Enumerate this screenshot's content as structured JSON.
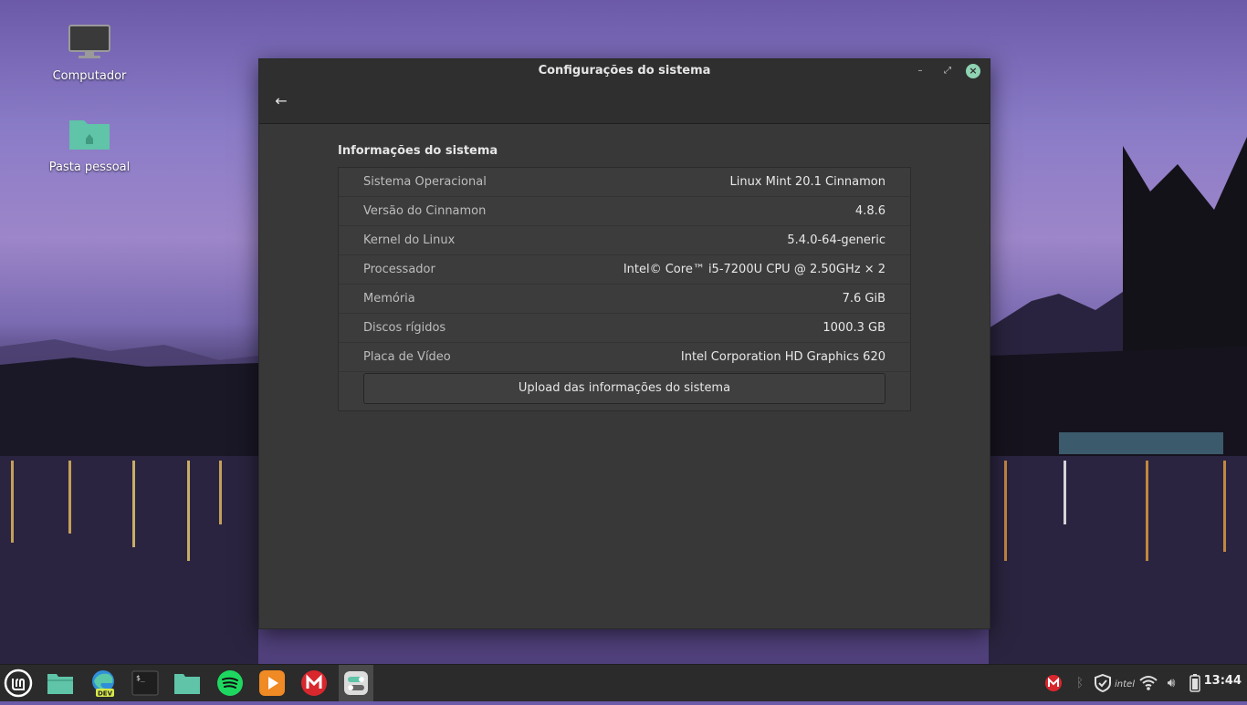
{
  "desktop": {
    "icons": [
      {
        "label": "Computador",
        "icon": "monitor-icon"
      },
      {
        "label": "Pasta pessoal",
        "icon": "home-folder-icon"
      }
    ]
  },
  "window": {
    "title": "Configurações do sistema",
    "section_title": "Informações do sistema",
    "rows": [
      {
        "label": "Sistema Operacional",
        "value": "Linux Mint 20.1 Cinnamon"
      },
      {
        "label": "Versão do Cinnamon",
        "value": "4.8.6"
      },
      {
        "label": "Kernel do Linux",
        "value": "5.4.0-64-generic"
      },
      {
        "label": "Processador",
        "value": "Intel© Core™ i5-7200U CPU @ 2.50GHz × 2"
      },
      {
        "label": "Memória",
        "value": "7.6 GiB"
      },
      {
        "label": "Discos rígidos",
        "value": "1000.3 GB"
      },
      {
        "label": "Placa de Vídeo",
        "value": "Intel Corporation HD Graphics 620"
      }
    ],
    "upload_label": "Upload das informações do sistema"
  },
  "taskbar": {
    "apps": [
      {
        "name": "mint-menu-icon"
      },
      {
        "name": "files-icon"
      },
      {
        "name": "edge-dev-icon",
        "badge": "DEV"
      },
      {
        "name": "terminal-icon"
      },
      {
        "name": "folder-icon"
      },
      {
        "name": "spotify-icon"
      },
      {
        "name": "media-player-icon"
      },
      {
        "name": "mega-icon"
      },
      {
        "name": "settings-icon"
      }
    ],
    "tray": [
      "mega-tray-icon",
      "bluetooth-icon",
      "shield-icon",
      "intel-icon",
      "wifi-icon",
      "volume-icon",
      "battery-icon"
    ],
    "clock": "13:44"
  },
  "colors": {
    "window_bg": "#383838",
    "titlebar_bg": "#2f2f2f",
    "accent_close": "#8fd3b2",
    "folder_teal": "#5fc4a8",
    "taskbar_bg": "#2b2b2b"
  }
}
